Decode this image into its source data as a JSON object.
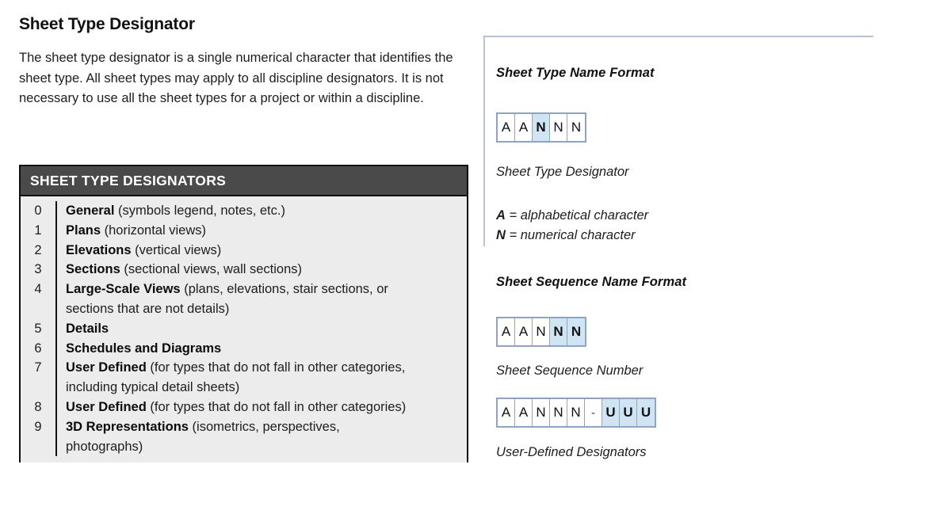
{
  "page": {
    "title": "Sheet Type Designator",
    "intro": "The sheet type designator is a single numerical character that identifies the sheet type. All sheet types may apply to all discipline designators. It is not necessary to use all the sheet types for a project or within a discipline."
  },
  "table": {
    "header": "SHEET TYPE DESIGNATORS",
    "rows": [
      {
        "num": "0",
        "name": "General",
        "detail": " (symbols legend, notes, etc.)",
        "continuation": ""
      },
      {
        "num": "1",
        "name": "Plans",
        "detail": " (horizontal views)",
        "continuation": ""
      },
      {
        "num": "2",
        "name": "Elevations",
        "detail": " (vertical views)",
        "continuation": ""
      },
      {
        "num": "3",
        "name": "Sections",
        "detail": " (sectional views, wall sections)",
        "continuation": ""
      },
      {
        "num": "4",
        "name": "Large-Scale Views",
        "detail": " (plans, elevations, stair sections, or",
        "continuation": "sections that are not details)"
      },
      {
        "num": "5",
        "name": "Details",
        "detail": "",
        "continuation": ""
      },
      {
        "num": "6",
        "name": "Schedules and Diagrams",
        "detail": "",
        "continuation": ""
      },
      {
        "num": "7",
        "name": "User Defined",
        "detail": " (for types that do not fall in other categories,",
        "continuation": "including typical detail sheets)"
      },
      {
        "num": "8",
        "name": "User Defined",
        "detail": " (for types that do not fall in other categories)",
        "continuation": ""
      },
      {
        "num": "9",
        "name": "3D Representations",
        "detail": " (isometrics, perspectives,",
        "continuation": "photographs)"
      }
    ]
  },
  "diagrams": {
    "sheet_type": {
      "heading": "Sheet Type Name Format",
      "caption": "Sheet Type Designator",
      "cells": [
        {
          "char": "A",
          "highlight": false
        },
        {
          "char": "A",
          "highlight": false
        },
        {
          "char": "N",
          "highlight": true
        },
        {
          "char": "N",
          "highlight": false
        },
        {
          "char": "N",
          "highlight": false
        }
      ]
    },
    "legend": [
      {
        "symbol": "A",
        "text": " = alphabetical character"
      },
      {
        "symbol": "N",
        "text": " = numerical character"
      }
    ],
    "sheet_sequence": {
      "heading": "Sheet Sequence Name Format",
      "caption": "Sheet Sequence Number",
      "cells": [
        {
          "char": "A",
          "highlight": false
        },
        {
          "char": "A",
          "highlight": false
        },
        {
          "char": "N",
          "highlight": false
        },
        {
          "char": "N",
          "highlight": true
        },
        {
          "char": "N",
          "highlight": true
        }
      ]
    },
    "user_defined": {
      "caption": "User-Defined Designators",
      "cells": [
        {
          "char": "A",
          "highlight": false
        },
        {
          "char": "A",
          "highlight": false
        },
        {
          "char": "N",
          "highlight": false
        },
        {
          "char": "N",
          "highlight": false
        },
        {
          "char": "N",
          "highlight": false
        },
        {
          "char": "-",
          "highlight": false
        },
        {
          "char": "U",
          "highlight": true
        },
        {
          "char": "U",
          "highlight": true
        },
        {
          "char": "U",
          "highlight": true
        }
      ]
    }
  },
  "colors": {
    "table_header_bg": "#4a4a4a",
    "table_body_bg": "#ececec",
    "table_border": "#0f0f0f",
    "panel_border": "#b6c2da",
    "box_border": "#8ea3c8",
    "box_highlight": "#cfe5f4"
  }
}
